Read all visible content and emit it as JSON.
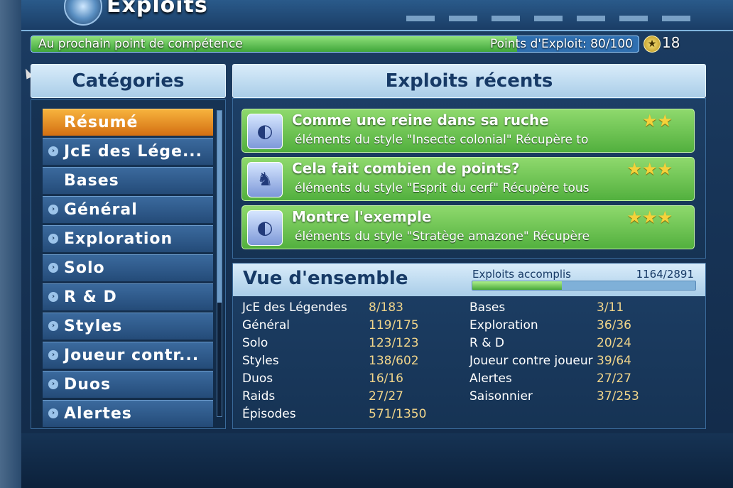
{
  "header": {
    "title": "Exploits"
  },
  "progress": {
    "left_label": "Au prochain point de compétence",
    "right_label": "Points d'Exploit: 80/100",
    "fraction": 0.8,
    "skill_points": "18"
  },
  "categories": {
    "heading": "Catégories",
    "items": [
      {
        "label": "Résumé",
        "active": true,
        "expand": false
      },
      {
        "label": "JcE des Lége...",
        "active": false,
        "expand": true
      },
      {
        "label": "Bases",
        "active": false,
        "expand": false
      },
      {
        "label": "Général",
        "active": false,
        "expand": true
      },
      {
        "label": "Exploration",
        "active": false,
        "expand": true
      },
      {
        "label": "Solo",
        "active": false,
        "expand": true
      },
      {
        "label": "R & D",
        "active": false,
        "expand": true
      },
      {
        "label": "Styles",
        "active": false,
        "expand": true
      },
      {
        "label": "Joueur contr...",
        "active": false,
        "expand": true
      },
      {
        "label": "Duos",
        "active": false,
        "expand": true
      },
      {
        "label": "Alertes",
        "active": false,
        "expand": true
      }
    ]
  },
  "recent": {
    "heading": "Exploits récents",
    "items": [
      {
        "title": "Comme une reine dans sa ruche",
        "desc": "éléments du style \"Insecte colonial\"   Récupère to",
        "stars": "★★",
        "icon": "mask-icon"
      },
      {
        "title": "Cela fait combien de points?",
        "desc": "éléments du style \"Esprit du cerf\"   Récupère tous",
        "stars": "★★★",
        "icon": "deer-spirit-icon"
      },
      {
        "title": "Montre l'exemple",
        "desc": "éléments du style \"Stratège amazone\"   Récupère",
        "stars": "★★★",
        "icon": "mask-icon"
      }
    ]
  },
  "overview": {
    "heading": "Vue d'ensemble",
    "accomplished_label": "Exploits accomplis",
    "accomplished_count": "1164/2891",
    "accomplished_fraction": 0.4026,
    "left": [
      {
        "name": "JcE des Légendes",
        "value": "8/183"
      },
      {
        "name": "Général",
        "value": "119/175"
      },
      {
        "name": "Solo",
        "value": "123/123"
      },
      {
        "name": "Styles",
        "value": "138/602"
      },
      {
        "name": "Duos",
        "value": "16/16"
      },
      {
        "name": "Raids",
        "value": "27/27"
      },
      {
        "name": "Épisodes",
        "value": "571/1350"
      }
    ],
    "right": [
      {
        "name": "Bases",
        "value": "3/11"
      },
      {
        "name": "Exploration",
        "value": "36/36"
      },
      {
        "name": "R & D",
        "value": "20/24"
      },
      {
        "name": "Joueur contre joueur",
        "value": "39/64"
      },
      {
        "name": "Alertes",
        "value": "27/27"
      },
      {
        "name": "Saisonnier",
        "value": "37/253"
      }
    ]
  }
}
